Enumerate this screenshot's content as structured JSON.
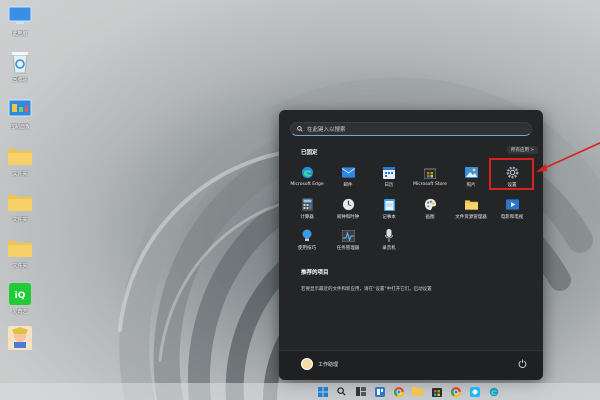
{
  "desktop": {
    "icons": [
      {
        "label": "此电脑",
        "icon": "computer-icon"
      },
      {
        "label": "回收站",
        "icon": "recycle-bin-icon"
      },
      {
        "label": "控制面板",
        "icon": "control-panel-icon"
      },
      {
        "label": "文件夹",
        "icon": "folder-icon"
      },
      {
        "label": "文件夹",
        "icon": "folder-icon"
      },
      {
        "label": "文件夹",
        "icon": "folder-icon"
      },
      {
        "label": "爱奇艺",
        "icon": "iqiyi-icon"
      },
      {
        "label": "",
        "icon": "game-icon"
      }
    ]
  },
  "start_menu": {
    "search_placeholder": "在此键入以搜索",
    "pinned_title": "已固定",
    "all_apps_label": "所有应用 >",
    "pinned_apps": [
      {
        "name": "Microsoft Edge",
        "icon": "edge-icon"
      },
      {
        "name": "邮件",
        "icon": "mail-icon"
      },
      {
        "name": "日历",
        "icon": "calendar-icon"
      },
      {
        "name": "Microsoft Store",
        "icon": "store-icon"
      },
      {
        "name": "照片",
        "icon": "photos-icon"
      },
      {
        "name": "设置",
        "icon": "settings-icon"
      },
      {
        "name": "计算器",
        "icon": "calculator-icon"
      },
      {
        "name": "闹钟和时钟",
        "icon": "clock-icon"
      },
      {
        "name": "记事本",
        "icon": "notepad-icon"
      },
      {
        "name": "画图",
        "icon": "paint-icon"
      },
      {
        "name": "文件资源管理器",
        "icon": "file-explorer-icon"
      },
      {
        "name": "电影和电视",
        "icon": "movies-icon"
      },
      {
        "name": "使用技巧",
        "icon": "tips-icon"
      },
      {
        "name": "任务管理器",
        "icon": "task-manager-icon"
      },
      {
        "name": "录音机",
        "icon": "recorder-icon"
      }
    ],
    "recommended_title": "推荐的项目",
    "recommended_text": "若要显示最近的文件和新应用，请在“设置”中打开它们。启动设置",
    "user_name": "工作助理"
  },
  "colors": {
    "highlight": "#d8221c",
    "menu_bg": "#232527",
    "accent": "#4a9be8"
  }
}
